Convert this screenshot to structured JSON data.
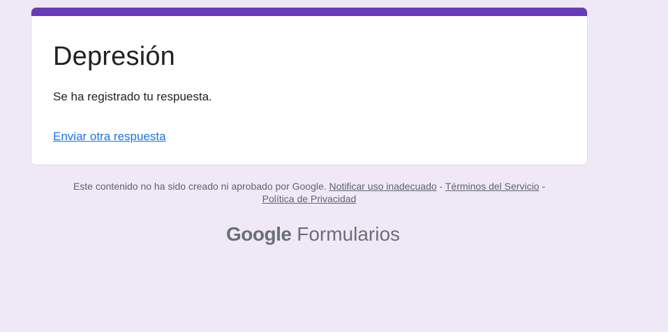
{
  "form": {
    "title": "Depresión",
    "confirmation": "Se ha registrado tu respuesta.",
    "submit_another": "Enviar otra respuesta"
  },
  "footer": {
    "disclaimer": "Este contenido no ha sido creado ni aprobado por Google.",
    "report_abuse": "Notificar uso inadecuado",
    "separator": "-",
    "terms": "Términos del Servicio",
    "privacy": "Política de Privacidad"
  },
  "brand": {
    "google": "Google",
    "product": "Formularios"
  },
  "colors": {
    "accent": "#673ab7",
    "background": "#efe9f7",
    "link": "#1a73e8"
  }
}
